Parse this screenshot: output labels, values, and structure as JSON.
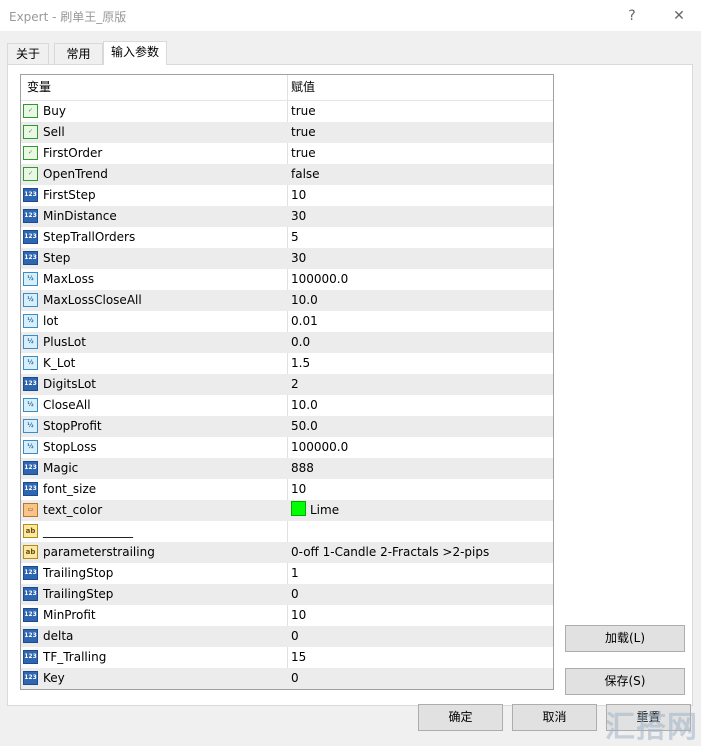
{
  "window": {
    "title": "Expert - 刷单王_原版",
    "help": "?",
    "close": "✕"
  },
  "tabs": [
    {
      "label": "关于"
    },
    {
      "label": "常用"
    },
    {
      "label": "输入参数"
    }
  ],
  "grid": {
    "columns": [
      "变量",
      "赋值"
    ],
    "rows": [
      {
        "type": "bool",
        "icon": "bool-icon",
        "badge": "✓",
        "name": "Buy",
        "value": "true"
      },
      {
        "type": "bool",
        "icon": "bool-icon",
        "badge": "✓",
        "name": "Sell",
        "value": "true"
      },
      {
        "type": "bool",
        "icon": "bool-icon",
        "badge": "✓",
        "name": "FirstOrder",
        "value": "true"
      },
      {
        "type": "bool",
        "icon": "bool-icon",
        "badge": "✓",
        "name": "OpenTrend",
        "value": "false"
      },
      {
        "type": "int",
        "icon": "integer-icon",
        "badge": "123",
        "name": "FirstStep",
        "value": "10"
      },
      {
        "type": "int",
        "icon": "integer-icon",
        "badge": "123",
        "name": "MinDistance",
        "value": "30"
      },
      {
        "type": "int",
        "icon": "integer-icon",
        "badge": "123",
        "name": "StepTrallOrders",
        "value": "5"
      },
      {
        "type": "int",
        "icon": "integer-icon",
        "badge": "123",
        "name": "Step",
        "value": "30"
      },
      {
        "type": "dbl",
        "icon": "double-icon",
        "badge": "½",
        "name": "MaxLoss",
        "value": "100000.0"
      },
      {
        "type": "dbl",
        "icon": "double-icon",
        "badge": "½",
        "name": "MaxLossCloseAll",
        "value": "10.0"
      },
      {
        "type": "dbl",
        "icon": "double-icon",
        "badge": "½",
        "name": "lot",
        "value": "0.01"
      },
      {
        "type": "dbl",
        "icon": "double-icon",
        "badge": "½",
        "name": "PlusLot",
        "value": "0.0"
      },
      {
        "type": "dbl",
        "icon": "double-icon",
        "badge": "½",
        "name": "K_Lot",
        "value": "1.5"
      },
      {
        "type": "int",
        "icon": "integer-icon",
        "badge": "123",
        "name": "DigitsLot",
        "value": "2"
      },
      {
        "type": "dbl",
        "icon": "double-icon",
        "badge": "½",
        "name": "CloseAll",
        "value": "10.0"
      },
      {
        "type": "dbl",
        "icon": "double-icon",
        "badge": "½",
        "name": "StopProfit",
        "value": "50.0"
      },
      {
        "type": "dbl",
        "icon": "double-icon",
        "badge": "½",
        "name": "StopLoss",
        "value": "100000.0"
      },
      {
        "type": "int",
        "icon": "integer-icon",
        "badge": "123",
        "name": "Magic",
        "value": "888"
      },
      {
        "type": "int",
        "icon": "integer-icon",
        "badge": "123",
        "name": "font_size",
        "value": "10"
      },
      {
        "type": "color",
        "icon": "color-icon",
        "badge": "▭",
        "name": "text_color",
        "value": "Lime",
        "swatch": "#00ff00"
      },
      {
        "type": "str",
        "icon": "string-icon",
        "badge": "ab",
        "name": "_______________",
        "value": ""
      },
      {
        "type": "str",
        "icon": "string-icon",
        "badge": "ab",
        "name": "parameterstrailing",
        "value": "0-off  1-Candle  2-Fractals  >2-pips"
      },
      {
        "type": "int",
        "icon": "integer-icon",
        "badge": "123",
        "name": "TrailingStop",
        "value": "1"
      },
      {
        "type": "int",
        "icon": "integer-icon",
        "badge": "123",
        "name": "TrailingStep",
        "value": "0"
      },
      {
        "type": "int",
        "icon": "integer-icon",
        "badge": "123",
        "name": "MinProfit",
        "value": "10"
      },
      {
        "type": "int",
        "icon": "integer-icon",
        "badge": "123",
        "name": "delta",
        "value": "0"
      },
      {
        "type": "int",
        "icon": "integer-icon",
        "badge": "123",
        "name": "TF_Tralling",
        "value": "15"
      },
      {
        "type": "int",
        "icon": "integer-icon",
        "badge": "123",
        "name": "Key",
        "value": "0"
      }
    ]
  },
  "buttons": {
    "load": "加载(L)",
    "save": "保存(S)",
    "ok": "确定",
    "cancel": "取消",
    "reset": "重置"
  },
  "watermark": "汇搭网"
}
